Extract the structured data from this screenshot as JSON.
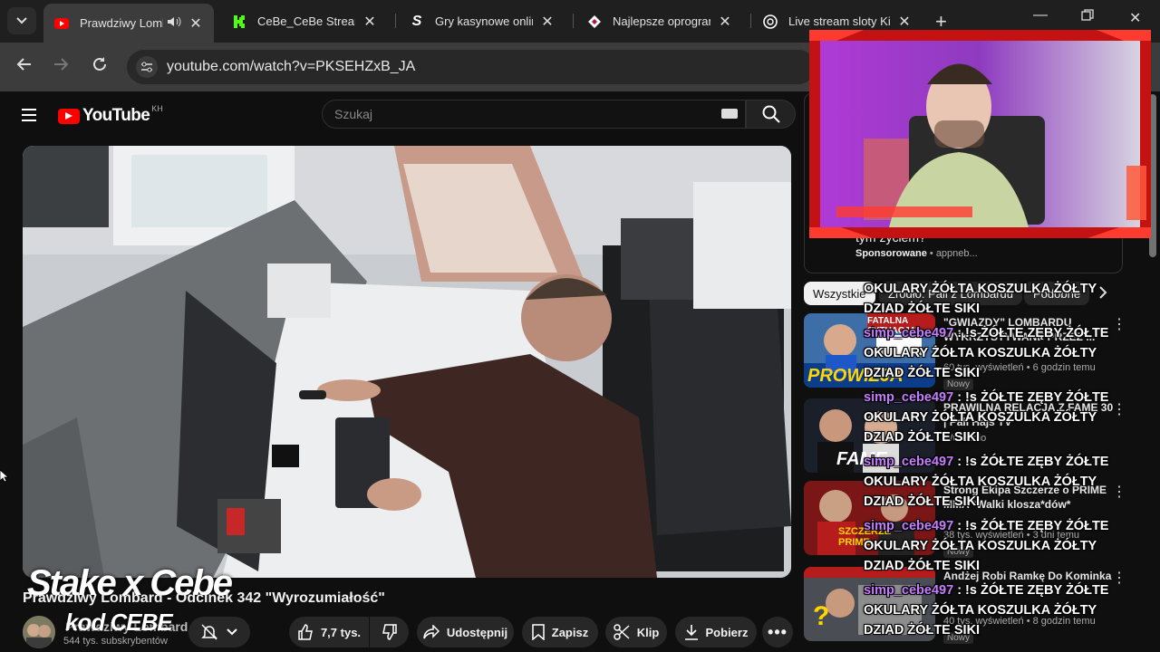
{
  "browser": {
    "tabs": [
      {
        "title": "Prawdziwy Lombard",
        "active": true,
        "icon": "youtube-icon"
      },
      {
        "title": "CeBe_CeBe Stream",
        "active": false,
        "icon": "kick-icon"
      },
      {
        "title": "Gry kasynowe online",
        "active": false,
        "icon": "stake-s-icon"
      },
      {
        "title": "Najlepsze oprogram",
        "active": false,
        "icon": "diamond-icon"
      },
      {
        "title": "Live stream sloty Ki",
        "active": false,
        "icon": "openai-icon"
      }
    ],
    "url": "youtube.com/watch?v=PKSEHZxB_JA"
  },
  "youtube": {
    "logo_text": "YouTube",
    "country_code": "KH",
    "search_placeholder": "Szukaj",
    "video_title": "Prawdziwy Lombard - Odcinek 342 \"Wyrozumiałość\"",
    "channel_name": "Prawdziwy Lombard",
    "subscribers": "544 tys. subskrybentów",
    "actions": {
      "likes": "7,7 tys.",
      "share": "Udostępnij",
      "save": "Zapisz",
      "clip": "Klip",
      "download": "Pobierz"
    },
    "sponsored": {
      "text": "tym życiem?",
      "label": "Sponsorowane",
      "advertiser": "appneb..."
    },
    "chips": [
      "Wszystkie",
      "Źródło: Pali z Lombardu",
      "Podobne"
    ],
    "recommendations": [
      {
        "title": "\"GWIAZDY\" LOMBARDU WYKRZYSTYWANE PRZEZ ...",
        "channel": "",
        "views": "60 tys. wyświetleń • 6 godzin temu",
        "badge": "Nowy"
      },
      {
        "title": "PRAWILNA RELACJA Z FAME 30 | Pali Hajs TV",
        "channel": "WuWunio",
        "views": "",
        "badge": ""
      },
      {
        "title": "Strong Ekipa Szczerze o PRIME MMA *Walki klosza*dów*",
        "channel": "",
        "views": "38 tys. wyświetleń • 3 dni temu",
        "badge": "Nowy"
      },
      {
        "title": "Andżej Robi Ramkę Do Kominka",
        "channel": "",
        "views": "40 tys. wyświetleń • 8 godzin temu",
        "badge": "Nowy"
      }
    ],
    "thumb_text": {
      "r1": "PROWIZJA",
      "r1_banner": "FATALNA SYTUACJA",
      "r2": "FAME",
      "r3": "SZCZERZE PRIME",
      "r4": "?"
    }
  },
  "overlay": {
    "brand": "Stake x Cebe",
    "code": "kod CEBE",
    "chat": [
      {
        "user": "",
        "text": "OKULARY ŻÓŁTA KOSZULKA ŻÓŁTY DZIAD ŻÓŁTE SIKI"
      },
      {
        "user": "simp_cebe497",
        "text": ": !s ŻÓŁTE ZĘBY ŻÓŁTE OKULARY ŻÓŁTA KOSZULKA ŻÓŁTY DZIAD ŻÓŁTE SIKI"
      },
      {
        "user": "simp_cebe497",
        "text": ": !s ŻÓŁTE ZĘBY ŻÓŁTE OKULARY ŻÓŁTA KOSZULKA ŻÓŁTY DZIAD ŻÓŁTE SIKI"
      },
      {
        "user": "simp_cebe497",
        "text": ": !s ŻÓŁTE ZĘBY ŻÓŁTE OKULARY ŻÓŁTA KOSZULKA ŻÓŁTY DZIAD ŻÓŁTE SIKI"
      },
      {
        "user": "simp_cebe497",
        "text": ": !s ŻÓŁTE ZĘBY ŻÓŁTE OKULARY ŻÓŁTA KOSZULKA ŻÓŁTY DZIAD ŻÓŁTE SIKI"
      },
      {
        "user": "simp_cebe497",
        "text": ": !s ŻÓŁTE ZĘBY ŻÓŁTE OKULARY ŻÓŁTA KOSZULKA ŻÓŁTY DZIAD ŻÓŁTE SIKI"
      }
    ]
  },
  "colors": {
    "youtube_red": "#ff0000",
    "chat_user": "#c77dff",
    "overlay_frame": "#e0161b",
    "cam_bg": "#a030d0"
  }
}
